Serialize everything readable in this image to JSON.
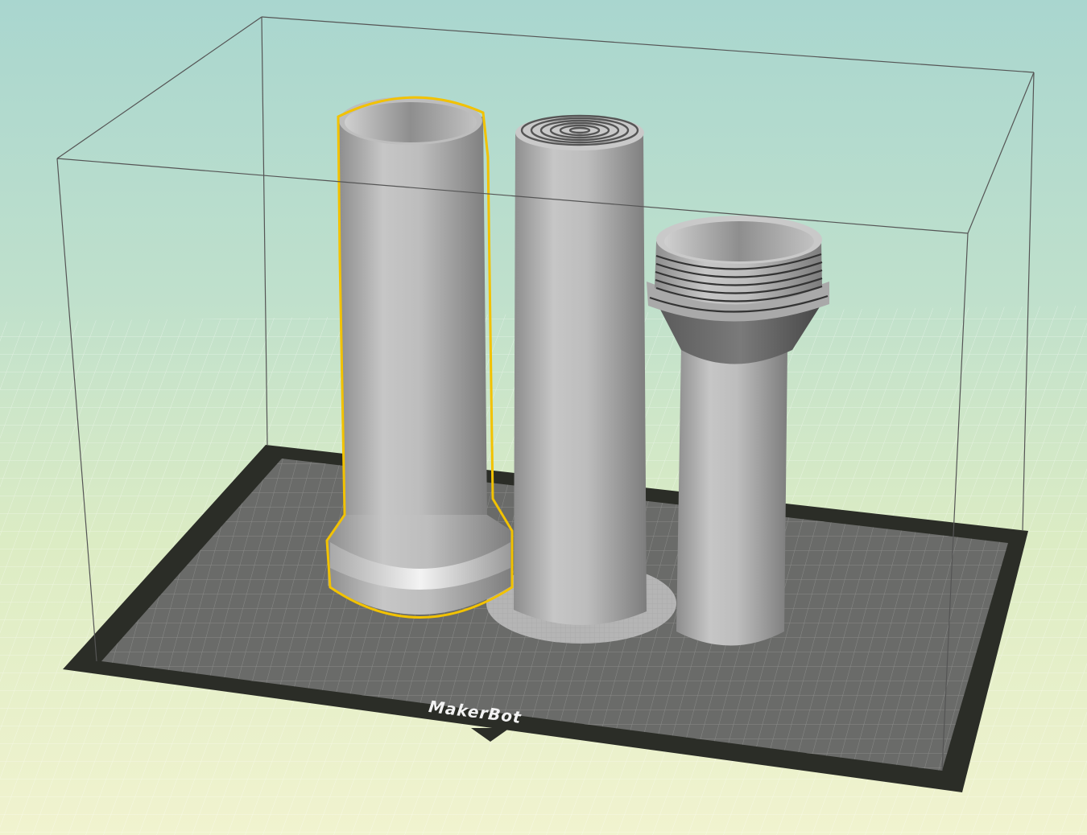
{
  "app": {
    "view": "3d-build-volume"
  },
  "plate": {
    "brand_label": "MakerBot"
  },
  "objects": [
    {
      "name": "tall-cylinder-with-flared-base",
      "selected": true
    },
    {
      "name": "cylinder-with-concentric-rings",
      "selected": false
    },
    {
      "name": "threaded-cup-cylinder",
      "selected": false
    }
  ],
  "colors": {
    "selection_outline": "#f2c200",
    "plate_border": "#2b2d27",
    "plate_surface": "#6a6b69",
    "object_gray": "#b8b8b8",
    "bounding_box": "#555555",
    "background_top": "#a9d6cf",
    "background_bottom": "#f1f3cf"
  }
}
